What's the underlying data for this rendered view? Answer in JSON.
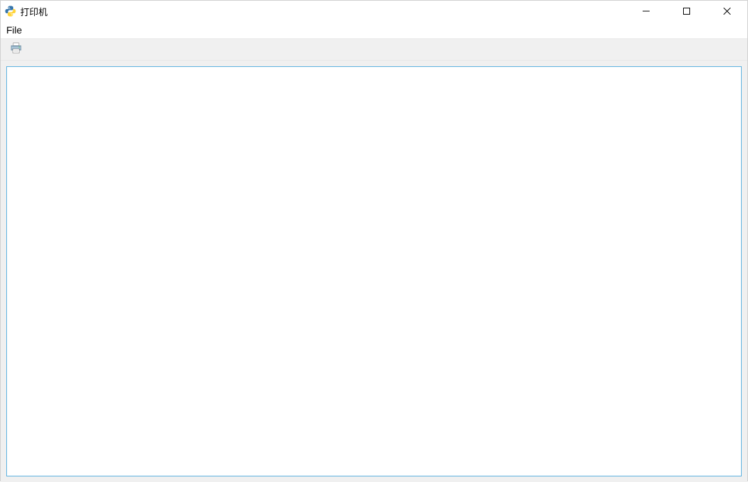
{
  "window": {
    "title": "打印机"
  },
  "menubar": {
    "items": [
      {
        "label": "File"
      }
    ]
  },
  "toolbar": {
    "print_tooltip": "Print"
  },
  "editor": {
    "content": ""
  }
}
